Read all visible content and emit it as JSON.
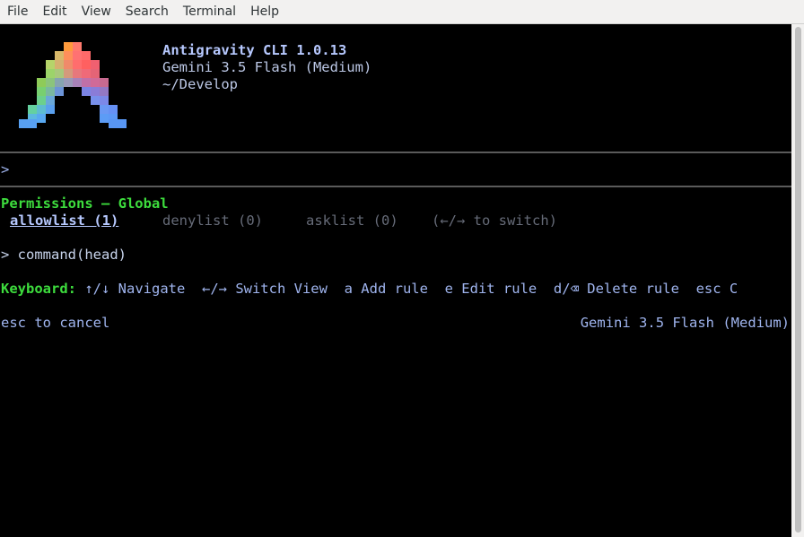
{
  "menu": [
    "File",
    "Edit",
    "View",
    "Search",
    "Terminal",
    "Help"
  ],
  "header": {
    "app_title": "Antigravity CLI 1.0.13",
    "model": "Gemini 3.5 Flash (Medium)",
    "path": "~/Develop"
  },
  "prompt": ">",
  "permissions": {
    "heading": "Permissions — Global",
    "tabs": [
      {
        "label": "allowlist (1)",
        "active": true
      },
      {
        "label": "denylist (0)",
        "active": false
      },
      {
        "label": "asklist (0)",
        "active": false
      }
    ],
    "switch_hint": "(←/→ to switch)",
    "selected_rule": "> command(head)"
  },
  "keyboard": {
    "label": "Keyboard:",
    "hints": "↑/↓ Navigate  ←/→ Switch View  a Add rule  e Edit rule  d/⌫ Delete rule  esc C"
  },
  "footer": {
    "cancel": "esc to cancel",
    "model": "Gemini 3.5 Flash (Medium)"
  },
  "colors": {
    "heading_green": "#3ddc3d",
    "accent_blue": "#b7c9ff",
    "dim": "#666b78"
  }
}
